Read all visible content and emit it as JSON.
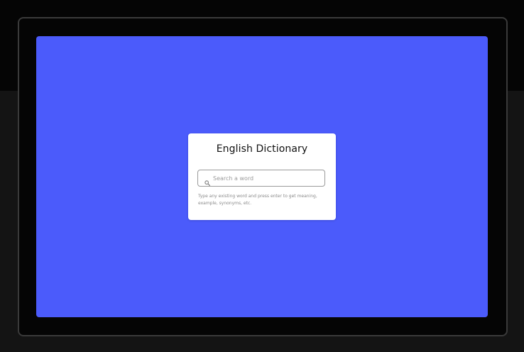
{
  "app": {
    "title": "English Dictionary"
  },
  "search": {
    "placeholder": "Search a word",
    "value": "",
    "icon": "search-icon"
  },
  "hint": {
    "text": "Type any existing word and press enter to get meaning, example, synonyms, etc."
  },
  "colors": {
    "page_background": "#141414",
    "frame_background": "#050505",
    "screen_background": "#4b5bfb",
    "card_background": "#ffffff"
  }
}
